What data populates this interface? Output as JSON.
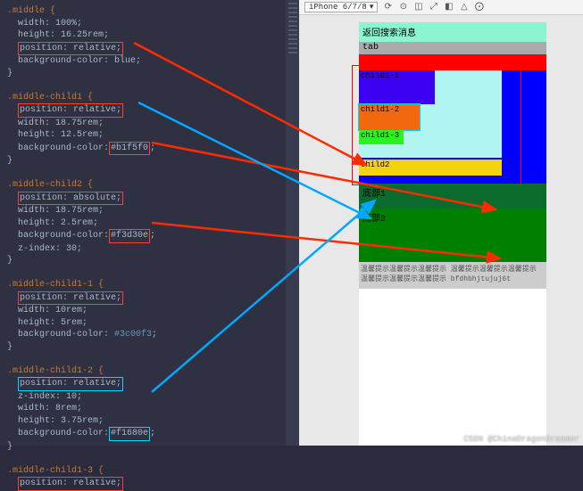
{
  "code": {
    "selectors": [
      ".middle",
      ".middle-child1",
      ".middle-child2",
      ".middle-child1-1",
      ".middle-child1-2",
      ".middle-child1-3"
    ],
    "block1": {
      "sel": ".middle {",
      "l1": "  width: 100%;",
      "l2": "  height: 16.25rem;",
      "pos": "position: relative;",
      "l4": "  background-color: blue;",
      "end": "}"
    },
    "block2": {
      "sel": ".middle-child1 {",
      "pos": "position: relative;",
      "l2": "  width: 18.75rem;",
      "l3": "  height: 12.5rem;",
      "bg_p": "  background-color:",
      "hex": "#b1f5f0",
      "end": "}"
    },
    "block3": {
      "sel": ".middle-child2 {",
      "pos": "position: absolute;",
      "l2": "  width: 18.75rem;",
      "l3": "  height: 2.5rem;",
      "bg_p": "  background-color:",
      "hex": "#f3d30e",
      "l5": "  z-index: 30;",
      "end": "}"
    },
    "block4": {
      "sel": ".middle-child1-1 {",
      "pos": "position: relative;",
      "l2": "  width: 10rem;",
      "l3": "  height: 5rem;",
      "bg_p": "  background-color: ",
      "hex": "#3c00f3",
      "end": "}"
    },
    "block5": {
      "sel": ".middle-child1-2 {",
      "pos": "position: relative;",
      "l2": "  z-index: 10;",
      "l3": "  width: 8rem;",
      "l4": "  height: 3.75rem;",
      "bg_p": "  background-color:",
      "hex": "#f1680e",
      "end": "}"
    },
    "block6": {
      "sel": ".middle-child1-3 {",
      "pos": "position: relative;"
    }
  },
  "devtools": {
    "device": "iPhone 6/7/8",
    "icons": [
      "⟳",
      "⊙",
      "◫",
      "⤢",
      "◧",
      "△",
      "⨀"
    ]
  },
  "preview": {
    "header": "返回搜索消息",
    "tab": "tab",
    "c11": "child1-1",
    "c12": "child1-2",
    "c13": "child1-3",
    "c2": "child2",
    "bot1": "底部1",
    "bot2": "底部2",
    "tips": "温馨提示温馨提示温馨提示 温馨提示温馨提示温馨提示 温馨提示温馨提示温馨提示 bfdhbhjtujuj6t"
  },
  "watermark": "CSDN @ChinaDragonDreamer"
}
